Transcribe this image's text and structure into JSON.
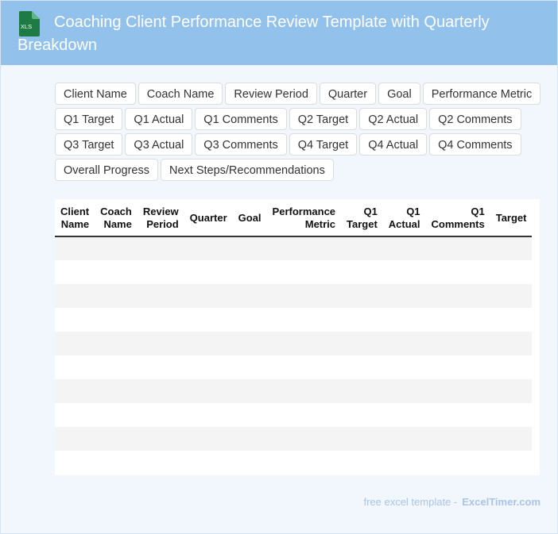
{
  "header": {
    "badge_text": "XLS",
    "title": "Coaching Client Performance Review Template with Quarterly Breakdown",
    "badge_color": "#1e7b45",
    "background_color": "#92c1ec"
  },
  "fields": [
    "Client Name",
    "Coach Name",
    "Review Period",
    "Quarter",
    "Goal",
    "Performance Metric",
    "Q1 Target",
    "Q1 Actual",
    "Q1 Comments",
    "Q2 Target",
    "Q2 Actual",
    "Q2 Comments",
    "Q3 Target",
    "Q3 Actual",
    "Q3 Comments",
    "Q4 Target",
    "Q4 Actual",
    "Q4 Comments",
    "Overall Progress",
    "Next Steps/Recommendations"
  ],
  "table": {
    "columns": [
      [
        "Client",
        "Name"
      ],
      [
        "Coach",
        "Name"
      ],
      [
        "Review",
        "Period"
      ],
      [
        "Quarter",
        ""
      ],
      [
        "Goal",
        ""
      ],
      [
        "Performance",
        "Metric"
      ],
      [
        "Q1",
        "Target"
      ],
      [
        "Q1",
        "Actual"
      ],
      [
        "Q1",
        "Comments"
      ],
      [
        "Target",
        ""
      ]
    ],
    "empty_rows": 10
  },
  "footer": {
    "label": "free excel template -",
    "brand": "ExcelTimer.com"
  }
}
